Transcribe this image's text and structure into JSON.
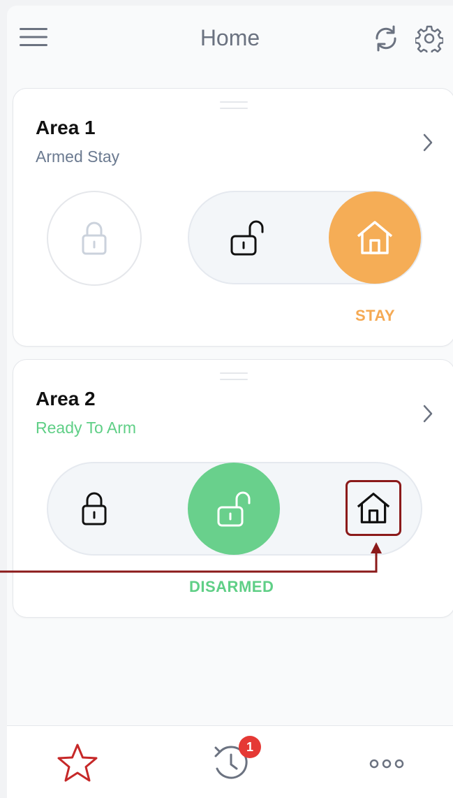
{
  "header": {
    "title": "Home"
  },
  "areas": [
    {
      "name": "Area 1",
      "status": "Armed Stay",
      "status_color": "#6b7a90",
      "mode_label": "STAY",
      "mode_color": "#f5a953"
    },
    {
      "name": "Area 2",
      "status": "Ready To Arm",
      "status_color": "#5fcf86",
      "mode_label": "DISARMED",
      "mode_color": "#5fcf86"
    }
  ],
  "colors": {
    "stay": "#f5ad56",
    "disarmed": "#69d08c",
    "highlight": "#8b1a1a",
    "badge": "#e53935",
    "star": "#c62828"
  },
  "bottom_nav": {
    "history_badge": "1"
  }
}
